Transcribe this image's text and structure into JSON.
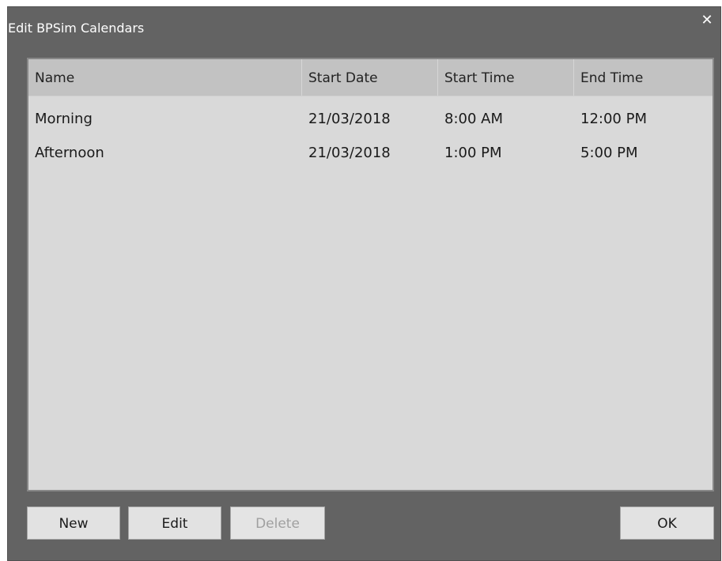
{
  "dialog": {
    "title": "Edit BPSim Calendars",
    "close_icon": "close-icon",
    "close_glyph": "✕"
  },
  "table": {
    "columns": [
      "Name",
      "Start Date",
      "Start Time",
      "End Time"
    ],
    "rows": [
      [
        "Morning",
        "21/03/2018",
        "8:00 AM",
        "12:00 PM"
      ],
      [
        "Afternoon",
        "21/03/2018",
        "1:00 PM",
        "5:00 PM"
      ]
    ]
  },
  "buttons": {
    "new_label": "New",
    "edit_label": "Edit",
    "delete_label": "Delete",
    "ok_label": "OK",
    "delete_enabled": false
  },
  "colors": {
    "dialog_bg": "#636363",
    "table_bg": "#d9d9d9",
    "header_bg": "#c2c2c2",
    "button_bg": "#e2e2e2",
    "disabled_text": "#a0a0a0"
  }
}
